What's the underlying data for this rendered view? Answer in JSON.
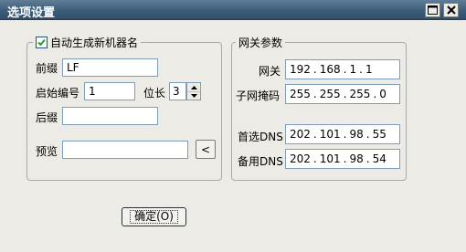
{
  "window": {
    "title": "选项设置",
    "buttons": {
      "maximize_icon": "maximize-icon",
      "close_icon": "close-icon"
    }
  },
  "left_group": {
    "auto_generate_label": "自动生成新机器名",
    "auto_generate_checked": true,
    "prefix_label": "前缀",
    "prefix_value": "LF",
    "start_number_label": "启始编号",
    "start_number_value": "1",
    "digits_label": "位长",
    "digits_value": "3",
    "suffix_label": "后缀",
    "suffix_value": "",
    "preview_label": "预览",
    "preview_value": "",
    "preview_button_label": "<"
  },
  "network_group": {
    "title": "网关参数",
    "gateway_label": "网关",
    "gateway": [
      "192",
      "168",
      "1",
      "1"
    ],
    "subnet_label": "子网掩码",
    "subnet": [
      "255",
      "255",
      "255",
      "0"
    ],
    "dns1_label": "首选DNS",
    "dns1": [
      "202",
      "101",
      "98",
      "55"
    ],
    "dns2_label": "备用DNS",
    "dns2": [
      "202",
      "101",
      "98",
      "54"
    ]
  },
  "ok_button_label": "确定(O)",
  "colors": {
    "titlebar": "#3e5d7a",
    "window_bg": "#ecebe6",
    "input_border": "#7f9db9"
  }
}
